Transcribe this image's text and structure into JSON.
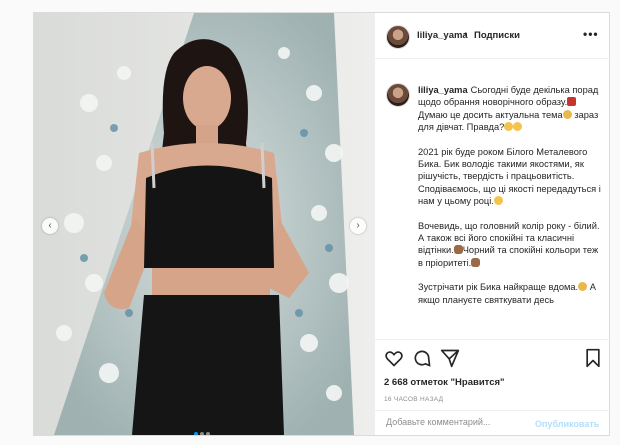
{
  "header": {
    "username": "liliya_yama",
    "dot": "•",
    "follow_label": "Подписки",
    "more": "•••"
  },
  "caption": {
    "username": "liliya_yama",
    "p1_a": "Сьогодні буде декілька порад щодо обрання новорічного образу.",
    "p1_b": "Думаю це досить актуальна тема",
    "p1_c": " зараз для дівчат. Правда?",
    "p2": "2021 рік буде роком Білого Металевого Бика. Бик володіє такими якостями, як рішучість, твердість і працьовитість. Сподіваємось, що ці якості передадуться і нам у цьому році.",
    "p3_a": "Вочевидь, що головний колір року - білий. А також всі його спокійні та класичні відтінки.",
    "p3_b": "Чорний та спокійні кольори теж в пріоритеті.",
    "p4": "Зустрічати рік Бика найкраще вдома.",
    "p4_b": " А якщо плануєте святкувати десь"
  },
  "likes": "2 668 отметок \"Нравится\"",
  "time_ago": "16 ЧАСОВ НАЗАД",
  "comment": {
    "placeholder": "Добавьте комментарий...",
    "publish": "Опубликовать"
  },
  "colors": {
    "link_disabled": "#b2dffc",
    "border": "#dbdbdb",
    "muted": "#8e8e8e",
    "carousel_dot_active": "#0095f6"
  },
  "icons": [
    "heart-icon",
    "comment-icon",
    "share-icon",
    "bookmark-icon",
    "more-icon",
    "chevron-left-icon",
    "chevron-right-icon"
  ]
}
